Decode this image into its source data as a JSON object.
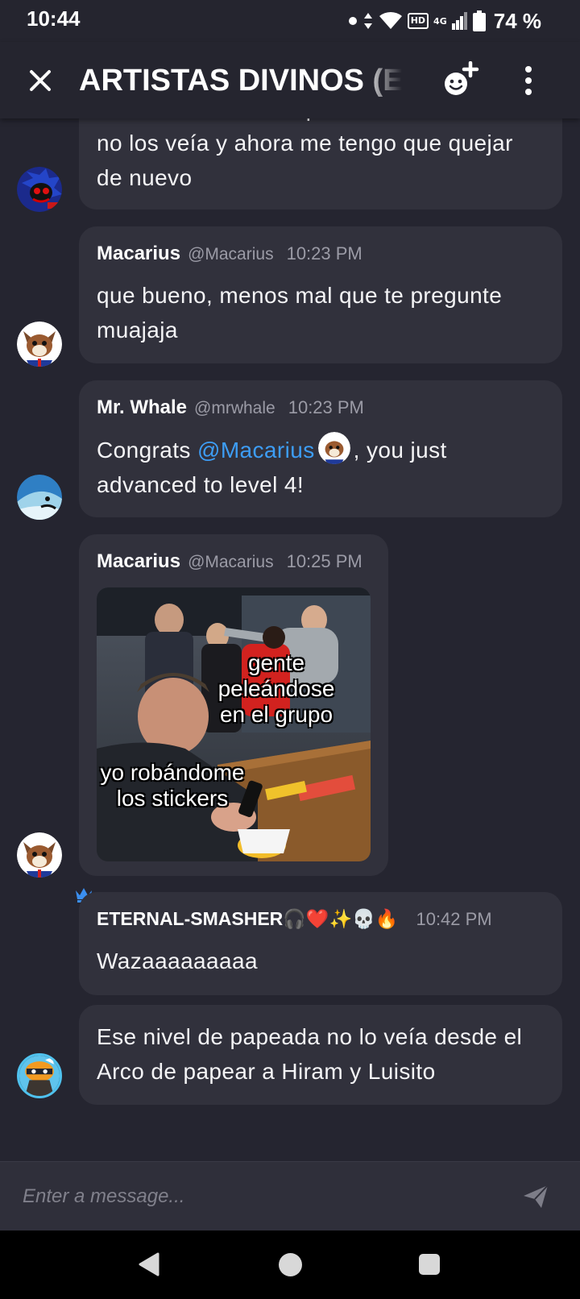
{
  "status_bar": {
    "time": "10:44",
    "battery_percent": "74 %",
    "network": "4G",
    "hd_badge": "HD"
  },
  "header": {
    "title": "ARTISTAS DIVINOS (E",
    "close_icon": "close-icon",
    "add_member_icon": "add-member-icon",
    "more_icon": "more-vertical-icon"
  },
  "messages": [
    {
      "id": "m1",
      "author": "",
      "text_lines": [
        "Estaba re contento que desde hace rato",
        "no los veía y ahora me tengo que quejar",
        "de nuevo"
      ]
    },
    {
      "id": "m2",
      "author": "Macarius",
      "handle": "@Macarius",
      "time": "10:23 PM",
      "text": "que bueno, menos mal que te pregunte muajaja"
    },
    {
      "id": "m3",
      "author": "Mr. Whale",
      "handle": "@mrwhale",
      "time": "10:23 PM",
      "text_before": "Congrats ",
      "mention": "@Macarius",
      "text_after": ", you just advanced to level 4!"
    },
    {
      "id": "m4",
      "author": "Macarius",
      "handle": "@Macarius",
      "time": "10:25 PM",
      "image": {
        "caption_top": "gente peleándose en el grupo",
        "caption_bottom": "yo robándome los stickers"
      }
    },
    {
      "id": "m5",
      "author": "ETERNAL-SMASHER🎧❤️✨💀🔥",
      "time": "10:42 PM",
      "text": "Wazaaaaaaaaa",
      "badge": "crown-icon"
    },
    {
      "id": "m6",
      "author": "",
      "text": "Ese nivel de papeada no lo veía desde el Arco de papear a Hiram y Luisito"
    }
  ],
  "composer": {
    "placeholder": "Enter a message...",
    "send_icon": "send-icon"
  },
  "colors": {
    "background": "#252530",
    "bubble": "#31313c",
    "mention": "#3d9df5",
    "crown": "#3b8ff0"
  }
}
